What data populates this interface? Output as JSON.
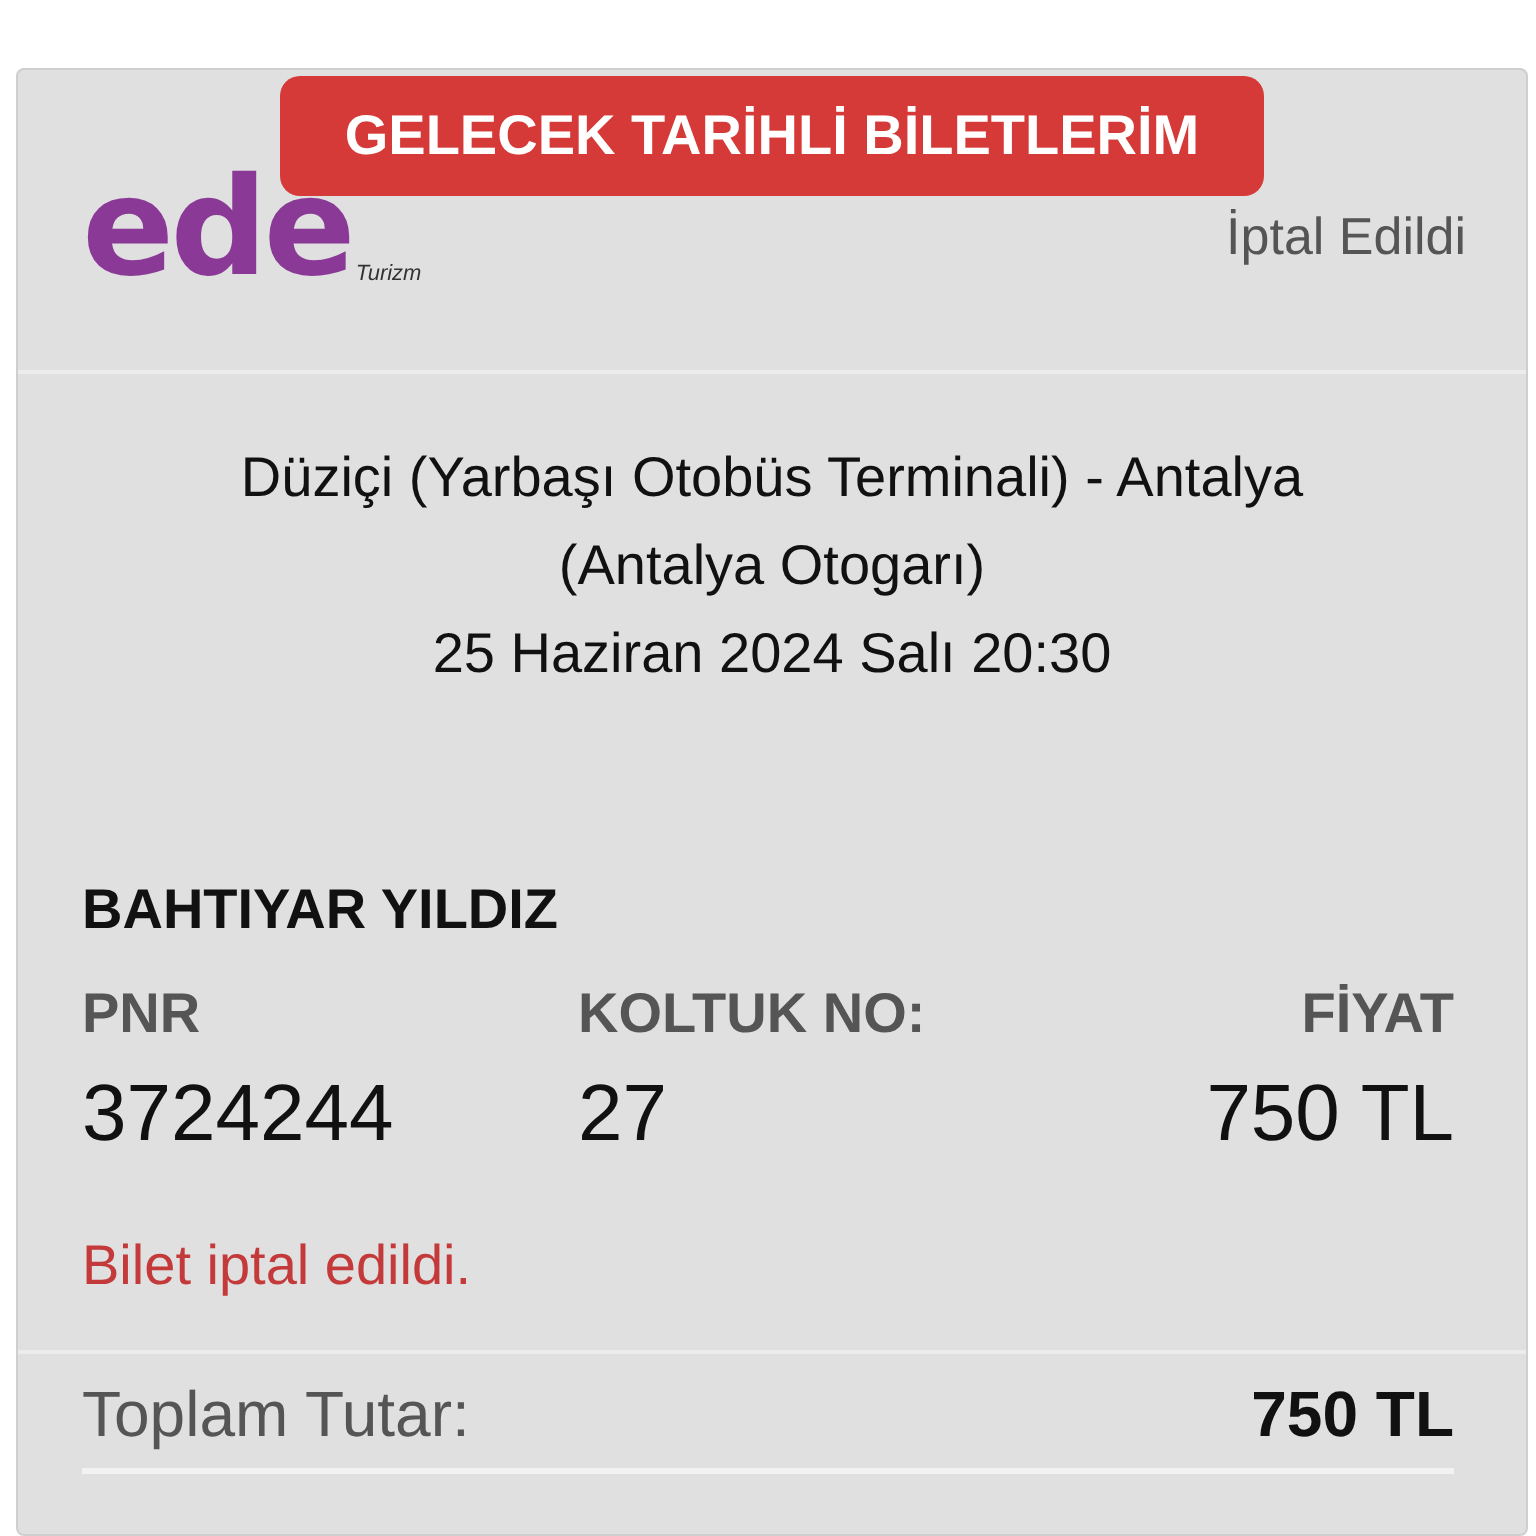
{
  "header": {
    "title": "GELECEK TARİHLİ BİLETLERİM"
  },
  "ticket": {
    "logo": {
      "name": "ede",
      "tagline": "Turizm"
    },
    "status": "İptal Edildi",
    "route": [
      "Düziçi (Yarbaşı Otobüs Terminali) - Antalya",
      "(Antalya Otogarı)"
    ],
    "date": "25 Haziran 2024 Salı 20:30",
    "passenger": "BAHTIYAR YILDIZ",
    "fields": [
      {
        "label": "PNR",
        "value": "3724244"
      },
      {
        "label": "KOLTUK NO:",
        "value": "27"
      },
      {
        "label": "FİYAT",
        "value": "750 TL"
      }
    ],
    "message": "Bilet iptal edildi.",
    "total": {
      "label": "Toplam Tutar:",
      "value": "750 TL"
    }
  }
}
